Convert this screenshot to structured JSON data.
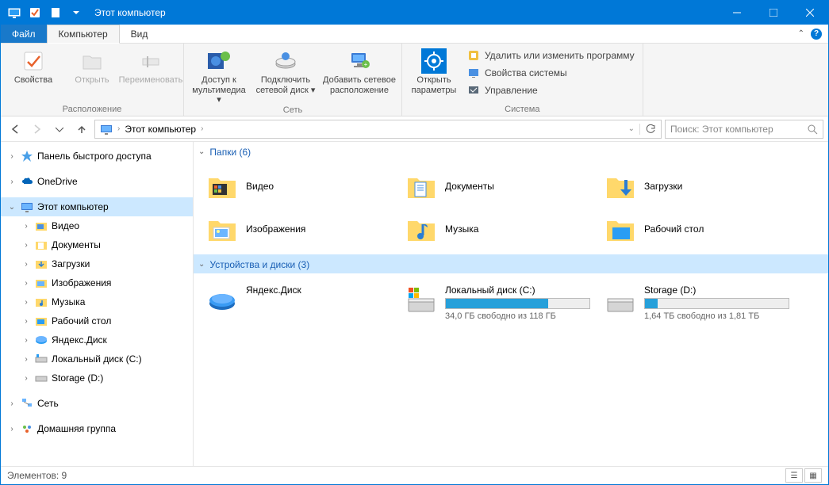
{
  "window": {
    "title": "Этот компьютер"
  },
  "menu": {
    "file": "Файл",
    "computer": "Компьютер",
    "view": "Вид"
  },
  "ribbon": {
    "location_group": "Расположение",
    "properties": "Свойства",
    "open": "Открыть",
    "rename": "Переименовать",
    "network_group": "Сеть",
    "media_access": "Доступ к мультимедиа",
    "map_drive": "Подключить сетевой диск",
    "add_network": "Добавить сетевое расположение",
    "system_group": "Система",
    "open_settings": "Открыть параметры",
    "uninstall": "Удалить или изменить программу",
    "sys_props": "Свойства системы",
    "manage": "Управление"
  },
  "address": {
    "root": "Этот компьютер"
  },
  "search": {
    "placeholder": "Поиск: Этот компьютер"
  },
  "tree": {
    "quick": "Панель быстрого доступа",
    "onedrive": "OneDrive",
    "thispc": "Этот компьютер",
    "video": "Видео",
    "documents": "Документы",
    "downloads": "Загрузки",
    "pictures": "Изображения",
    "music": "Музыка",
    "desktop": "Рабочий стол",
    "yadisk": "Яндекс.Диск",
    "drivec": "Локальный диск (C:)",
    "drived": "Storage (D:)",
    "network": "Сеть",
    "homegroup": "Домашняя группа"
  },
  "groups": {
    "folders": "Папки (6)",
    "drives": "Устройства и диски (3)"
  },
  "folders": {
    "video": "Видео",
    "documents": "Документы",
    "downloads": "Загрузки",
    "pictures": "Изображения",
    "music": "Музыка",
    "desktop": "Рабочий стол"
  },
  "drives": {
    "yadisk": "Яндекс.Диск",
    "c_name": "Локальный диск (C:)",
    "c_sub": "34,0 ГБ свободно из 118 ГБ",
    "d_name": "Storage (D:)",
    "d_sub": "1,64 ТБ свободно из 1,81 ТБ"
  },
  "status": {
    "items": "Элементов: 9"
  }
}
